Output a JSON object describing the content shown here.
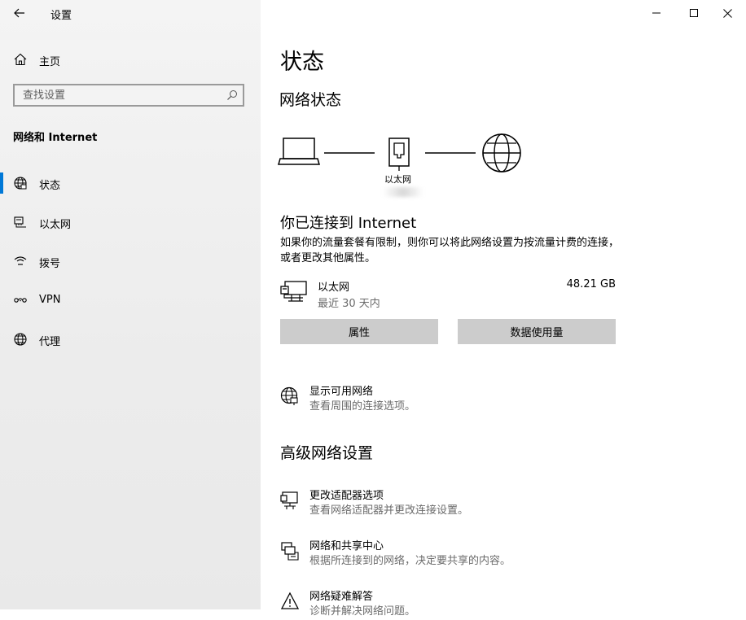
{
  "window": {
    "app_title": "设置",
    "controls": {
      "minimize": "minimize-icon",
      "maximize": "maximize-icon",
      "close": "close-icon"
    }
  },
  "sidebar": {
    "home_label": "主页",
    "search_placeholder": "查找设置",
    "section_title": "网络和 Internet",
    "items": [
      {
        "label": "状态",
        "icon": "globe-status-icon",
        "selected": true
      },
      {
        "label": "以太网",
        "icon": "ethernet-icon",
        "selected": false
      },
      {
        "label": "拨号",
        "icon": "dialup-icon",
        "selected": false
      },
      {
        "label": "VPN",
        "icon": "vpn-icon",
        "selected": false
      },
      {
        "label": "代理",
        "icon": "globe-icon",
        "selected": false
      }
    ],
    "accent_color": "#0078d7"
  },
  "main": {
    "page_title": "状态",
    "network_status_heading": "网络状态",
    "diagram": {
      "adapter_label": "以太网"
    },
    "connected_heading": "你已连接到 Internet",
    "connected_description": "如果你的流量套餐有限制，则你可以将此网络设置为按流量计费的连接，或者更改其他属性。",
    "connection": {
      "name": "以太网",
      "period": "最近 30 天内",
      "usage": "48.21 GB"
    },
    "buttons": {
      "properties": "属性",
      "data_usage": "数据使用量"
    },
    "show_networks": {
      "title": "显示可用网络",
      "desc": "查看周围的连接选项。"
    },
    "advanced_heading": "高级网络设置",
    "advanced_items": [
      {
        "title": "更改适配器选项",
        "desc": "查看网络适配器并更改连接设置。",
        "icon": "adapter-icon"
      },
      {
        "title": "网络和共享中心",
        "desc": "根据所连接到的网络，决定要共享的内容。",
        "icon": "sharing-center-icon"
      },
      {
        "title": "网络疑难解答",
        "desc": "诊断并解决网络问题。",
        "icon": "warning-icon"
      }
    ]
  }
}
